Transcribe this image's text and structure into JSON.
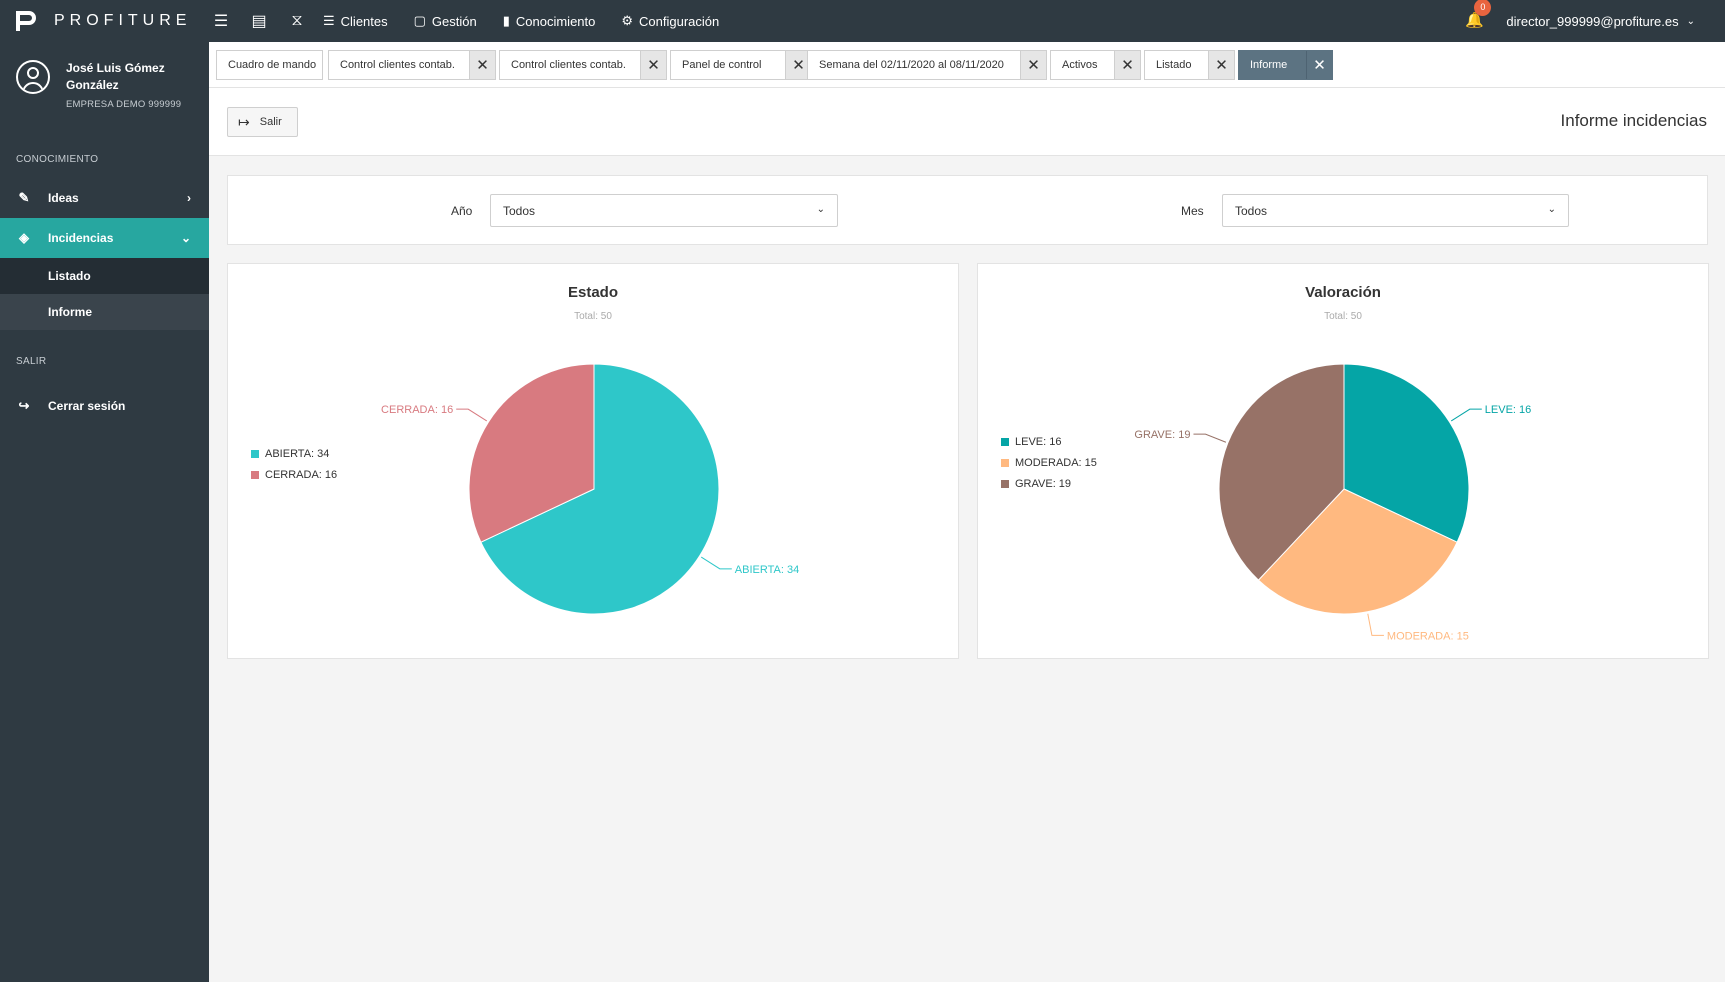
{
  "brand": {
    "name": "PROFITURE"
  },
  "topnav": {
    "items": [
      {
        "label": "Clientes",
        "icon": "layers-icon"
      },
      {
        "label": "Gestión",
        "icon": "monitor-icon"
      },
      {
        "label": "Conocimiento",
        "icon": "book-icon"
      },
      {
        "label": "Configuración",
        "icon": "gear-icon"
      }
    ],
    "notifications": "0",
    "user_email": "director_999999@profiture.es"
  },
  "profile": {
    "name": "José Luis Gómez González",
    "company": "EMPRESA DEMO 999999"
  },
  "sidebar": {
    "section_knowledge": "CONOCIMIENTO",
    "ideas": "Ideas",
    "incidencias": "Incidencias",
    "sub_listado": "Listado",
    "sub_informe": "Informe",
    "section_salir": "SALIR",
    "logout": "Cerrar sesión"
  },
  "tabs": [
    "Cuadro de mando",
    "Control clientes contab.",
    "Control clientes contab.",
    "Panel de control",
    "Semana del 02/11/2020 al 08/11/2020",
    "Activos",
    "Listado",
    "Informe"
  ],
  "header": {
    "exit_label": "Salir",
    "title": "Informe incidencias"
  },
  "filters": {
    "year_label": "Año",
    "year_value": "Todos",
    "month_label": "Mes",
    "month_value": "Todos"
  },
  "colors": {
    "abierta": "#2ec7c9",
    "cerrada": "#d87a80",
    "leve": "#05a5a6",
    "moderada": "#ffb980",
    "grave": "#977267"
  },
  "chart_data": [
    {
      "type": "pie",
      "title": "Estado",
      "subtitle": "Total: 50",
      "categories": [
        "ABIERTA",
        "CERRADA"
      ],
      "values": [
        34,
        16
      ],
      "legend": [
        "ABIERTA: 34",
        "CERRADA: 16"
      ],
      "labels": [
        "ABIERTA: 34",
        "CERRADA: 16"
      ],
      "legend_position": "left"
    },
    {
      "type": "pie",
      "title": "Valoración",
      "subtitle": "Total: 50",
      "categories": [
        "LEVE",
        "MODERADA",
        "GRAVE"
      ],
      "values": [
        16,
        15,
        19
      ],
      "legend": [
        "LEVE: 16",
        "MODERADA: 15",
        "GRAVE: 19"
      ],
      "labels": [
        "LEVE: 16",
        "MODERADA: 15",
        "GRAVE: 19"
      ],
      "legend_position": "left"
    }
  ]
}
